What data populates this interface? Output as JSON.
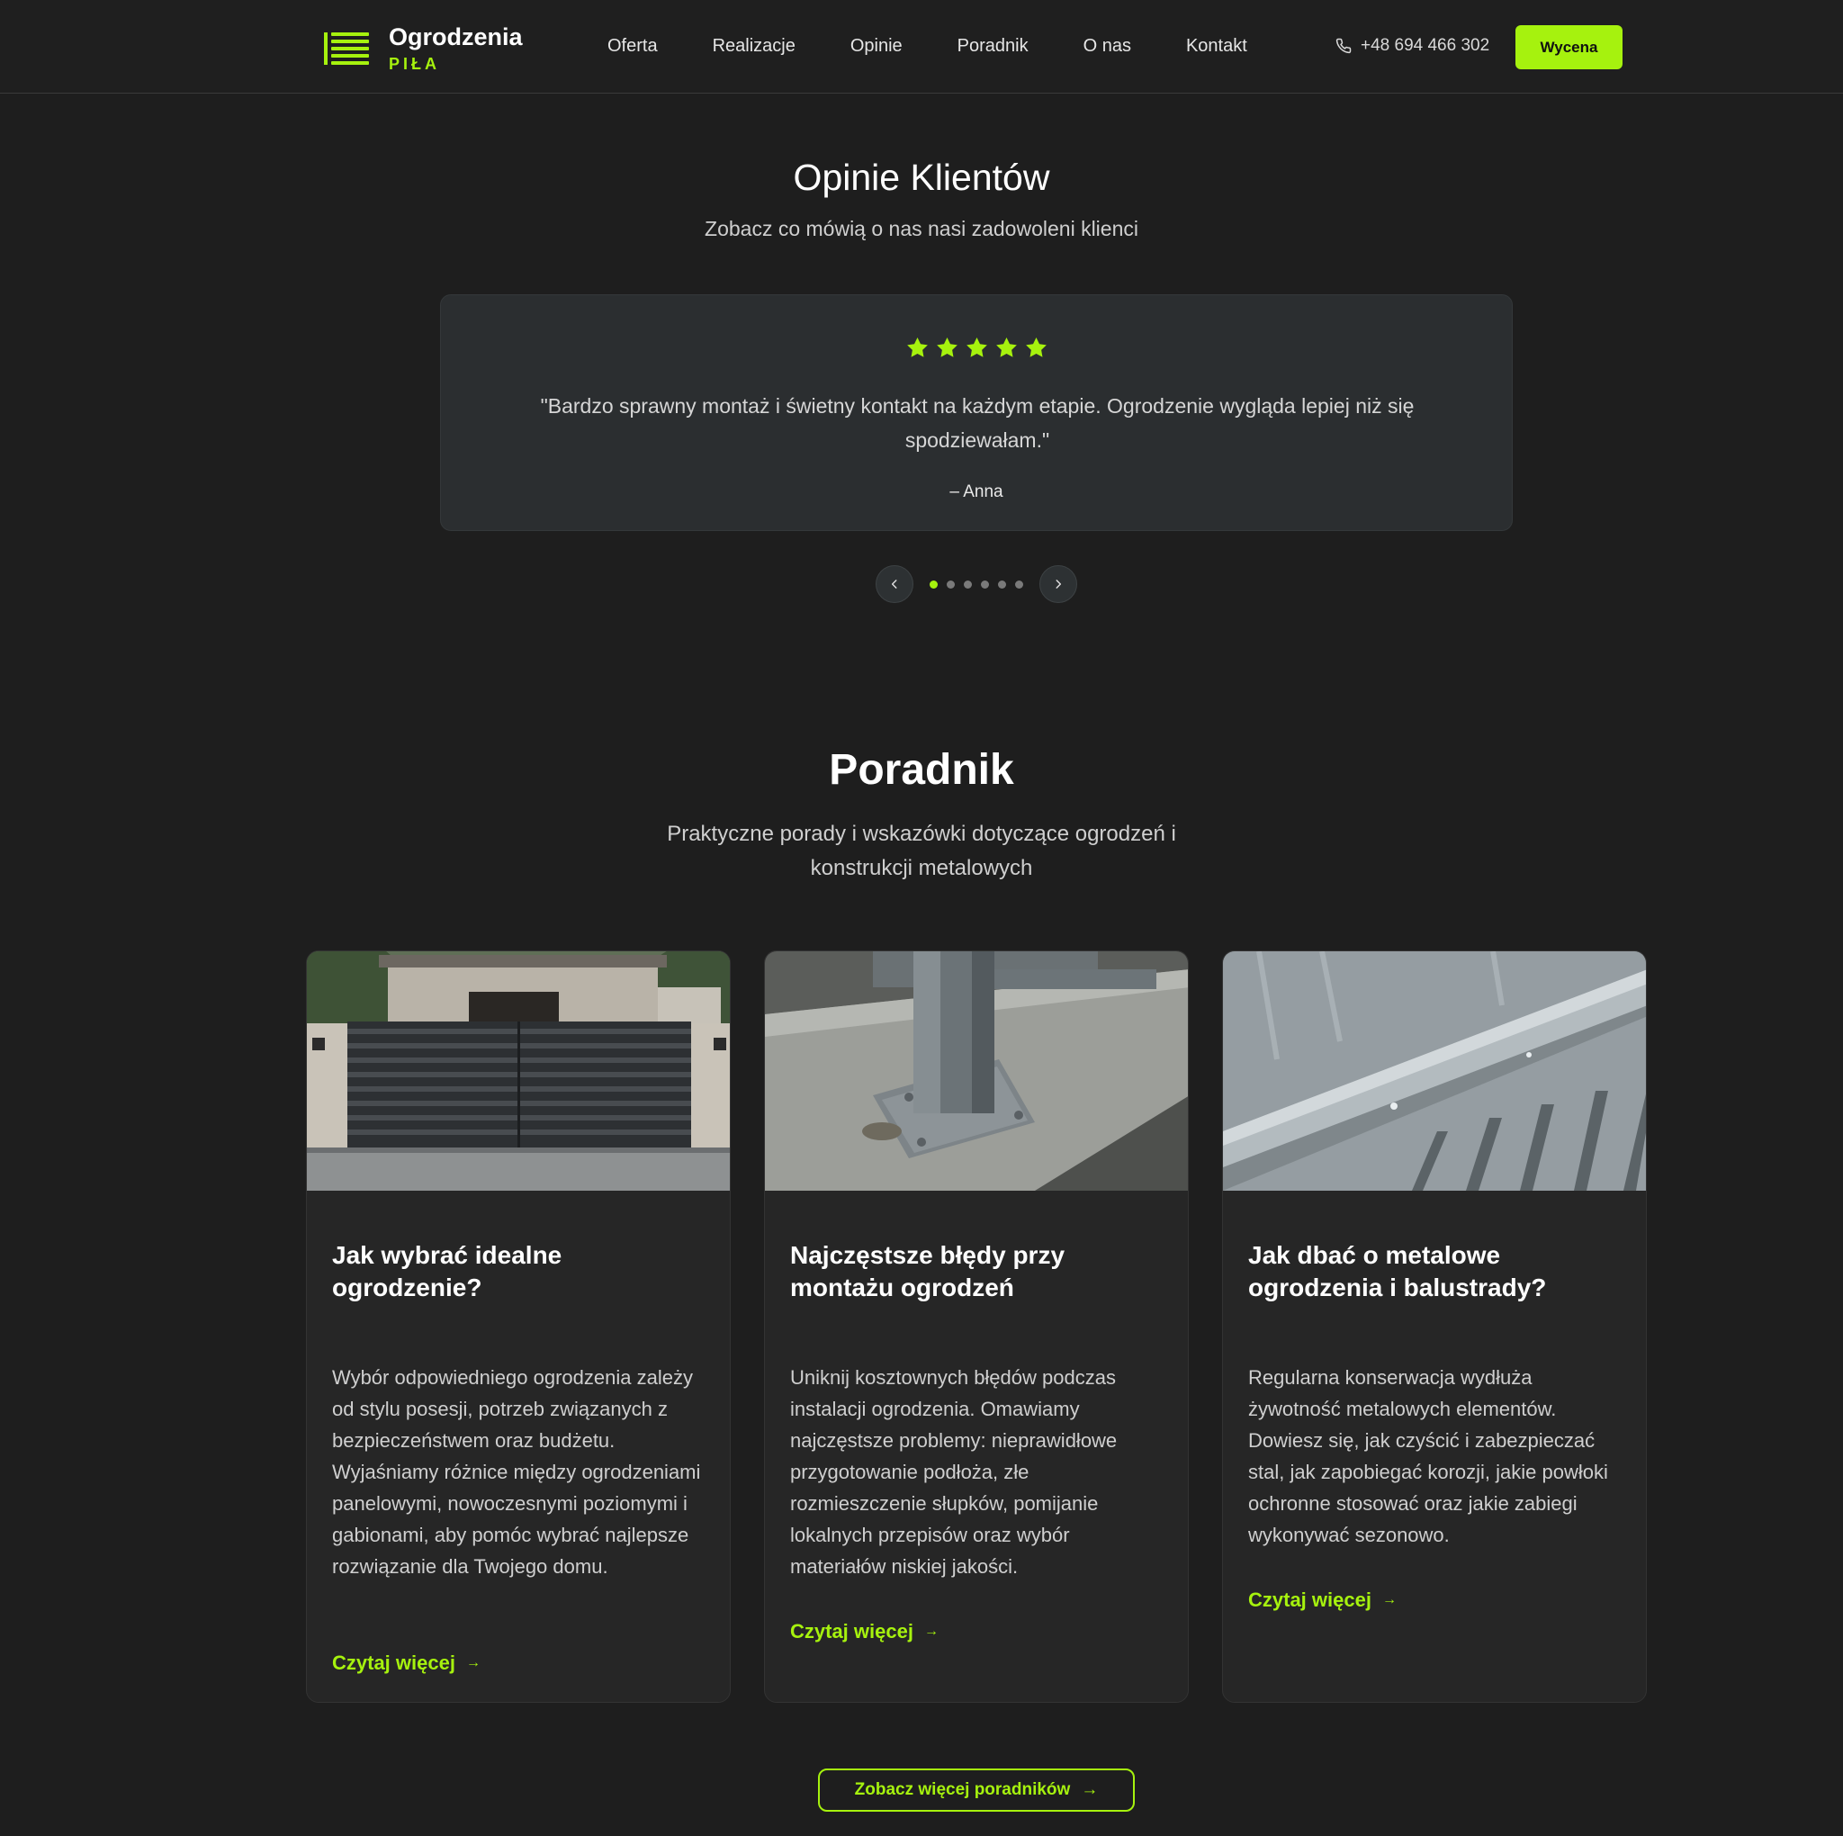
{
  "header": {
    "logo_title": "Ogrodzenia",
    "logo_sub": "PIŁA",
    "nav": [
      "Oferta",
      "Realizacje",
      "Opinie",
      "Poradnik",
      "O nas",
      "Kontakt"
    ],
    "phone": "+48 694 466 302",
    "cta": "Wycena"
  },
  "reviews": {
    "title": "Opinie Klientów",
    "subtitle": "Zobacz co mówią o nas nasi zadowoleni klienci",
    "rating": 5,
    "quote": "\"Bardzo sprawny montaż i świetny kontakt na każdym etapie. Ogrodzenie wygląda lepiej niż się spodziewałam.\"",
    "author": "– Anna",
    "slide_count": 6,
    "active_slide": 1
  },
  "guides": {
    "title": "Poradnik",
    "subtitle": "Praktyczne porady i wskazówki dotyczące ogrodzeń i konstrukcji metalowych",
    "cards": [
      {
        "title": "Jak wybrać idealne ogrodzenie?",
        "text": "Wybór odpowiedniego ogrodzenia zależy od stylu posesji, potrzeb związanych z bezpieczeństwem oraz budżetu. Wyjaśniamy różnice między ogrodzeniami panelowymi, nowoczesnymi poziomymi i gabionami, aby pomóc wybrać najlepsze rozwiązanie dla Twojego domu.",
        "link": "Czytaj więcej"
      },
      {
        "title": "Najczęstsze błędy przy montażu ogrodzeń",
        "text": "Uniknij kosztownych błędów podczas instalacji ogrodzenia. Omawiamy najczęstsze problemy: nieprawidłowe przygotowanie podłoża, złe rozmieszczenie słupków, pomijanie lokalnych przepisów oraz wybór materiałów niskiej jakości.",
        "link": "Czytaj więcej"
      },
      {
        "title": "Jak dbać o metalowe ogrodzenia i balustrady?",
        "text": "Regularna konserwacja wydłuża żywotność metalowych elementów. Dowiesz się, jak czyścić i zabezpieczać stal, jak zapobiegać korozji, jakie powłoki ochronne stosować oraz jakie zabiegi wykonywać sezonowo.",
        "link": "Czytaj więcej"
      }
    ],
    "more_button": "Zobacz więcej poradników"
  },
  "colors": {
    "accent": "#a6f20e",
    "background": "#1e1e1e",
    "card": "#262626"
  },
  "icons": [
    "logo-icon",
    "phone-icon",
    "star-icon",
    "chevron-left-icon",
    "chevron-right-icon",
    "arrow-right-icon"
  ]
}
